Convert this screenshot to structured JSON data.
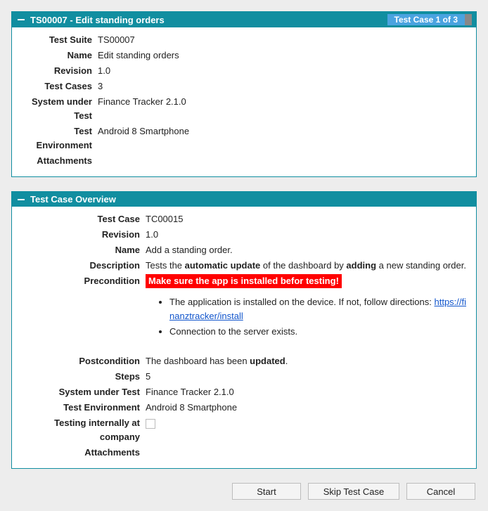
{
  "panel1": {
    "title": "TS00007 - Edit standing orders",
    "badge": "Test Case 1 of 3",
    "rows": {
      "testSuite": {
        "label": "Test Suite",
        "value": "TS00007"
      },
      "name": {
        "label": "Name",
        "value": "Edit standing orders"
      },
      "revision": {
        "label": "Revision",
        "value": "1.0"
      },
      "testCases": {
        "label": "Test Cases",
        "value": "3"
      },
      "sut": {
        "label": "System under Test",
        "value": "Finance Tracker 2.1.0"
      },
      "env": {
        "label": "Test Environment",
        "value": "Android 8 Smartphone"
      },
      "attachments": {
        "label": "Attachments",
        "value": ""
      }
    }
  },
  "panel2": {
    "title": "Test Case Overview",
    "rows": {
      "testCase": {
        "label": "Test Case",
        "value": "TC00015"
      },
      "revision": {
        "label": "Revision",
        "value": "1.0"
      },
      "name": {
        "label": "Name",
        "value": "Add a standing order."
      },
      "description": {
        "label": "Description",
        "pre": "Tests the ",
        "b1": "automatic update",
        "mid": " of the dashboard by ",
        "b2": "adding",
        "post": " a new standing order."
      },
      "precondition": {
        "label": "Precondition",
        "warning": "Make sure the app is installed befor testing!",
        "item1_text": "The application is installed on the device. If not, follow directions: ",
        "item1_link_text": "https://finanztracker/install",
        "item1_link_href": "https://finanztracker/install",
        "item2_text": "Connection to the server exists."
      },
      "postcondition": {
        "label": "Postcondition",
        "pre": "The dashboard has been ",
        "b1": "updated",
        "post": "."
      },
      "steps": {
        "label": "Steps",
        "value": "5"
      },
      "sut": {
        "label": "System under Test",
        "value": "Finance Tracker 2.1.0"
      },
      "env": {
        "label": "Test Environment",
        "value": "Android 8 Smartphone"
      },
      "internal": {
        "label": "Testing internally at company"
      },
      "attachments": {
        "label": "Attachments",
        "value": ""
      }
    }
  },
  "buttons": {
    "start": "Start",
    "skip": "Skip Test Case",
    "cancel": "Cancel"
  }
}
